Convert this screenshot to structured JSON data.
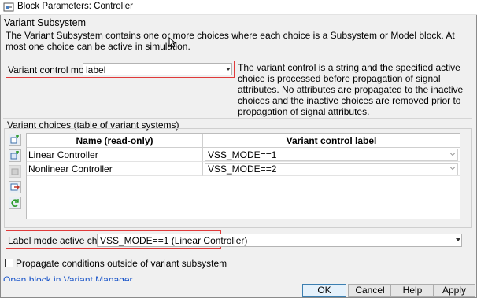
{
  "window": {
    "title": "Block Parameters: Controller",
    "icon": "simulink-block-icon"
  },
  "section_title": "Variant Subsystem",
  "description": "The Variant Subsystem contains one or more choices where each choice is a Subsystem or Model block. At most one choice can be active in simulation.",
  "variant_control_mode": {
    "label": "Variant control mode:",
    "value": "label",
    "help": "The variant control is a string and the specified active choice is processed before propagation of signal attributes. No attributes are propagated to the inactive choices and the inactive choices are removed prior to propagation of signal attributes."
  },
  "variant_choices": {
    "label": "Variant choices (table of variant systems)",
    "columns": [
      "Name (read-only)",
      "Variant control label"
    ],
    "rows": [
      {
        "name": "Linear Controller",
        "label": "VSS_MODE==1"
      },
      {
        "name": "Nonlinear Controller",
        "label": "VSS_MODE==2"
      }
    ],
    "toolbar_icons": [
      "add-subsystem-choice-icon",
      "add-model-choice-icon",
      "delete-choice-icon",
      "open-choice-icon",
      "refresh-icon"
    ]
  },
  "active_choice": {
    "label": "Label mode active choice:",
    "value": "VSS_MODE==1 (Linear Controller)"
  },
  "propagate": {
    "label": "Propagate conditions outside of variant subsystem",
    "checked": false
  },
  "link": "Open block in Variant Manager",
  "buttons": {
    "ok": "OK",
    "cancel": "Cancel",
    "help": "Help",
    "apply": "Apply"
  },
  "colors": {
    "highlight": "#e03a3a",
    "link": "#1a55c9"
  }
}
